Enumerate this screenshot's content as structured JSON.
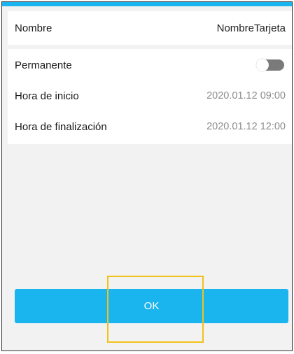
{
  "colors": {
    "accent": "#1ab4ef",
    "highlight": "#f2c21b",
    "toggle_off": "#7a7a7a"
  },
  "name_card": {
    "label": "Nombre",
    "value": "NombreTarjeta"
  },
  "schedule_card": {
    "permanent": {
      "label": "Permanente",
      "toggle_state": "off"
    },
    "start": {
      "label": "Hora de inicio",
      "value": "2020.01.12 09:00"
    },
    "end": {
      "label": "Hora de finalización",
      "value": "2020.01.12 12:00"
    }
  },
  "ok_button": {
    "label": "OK"
  }
}
